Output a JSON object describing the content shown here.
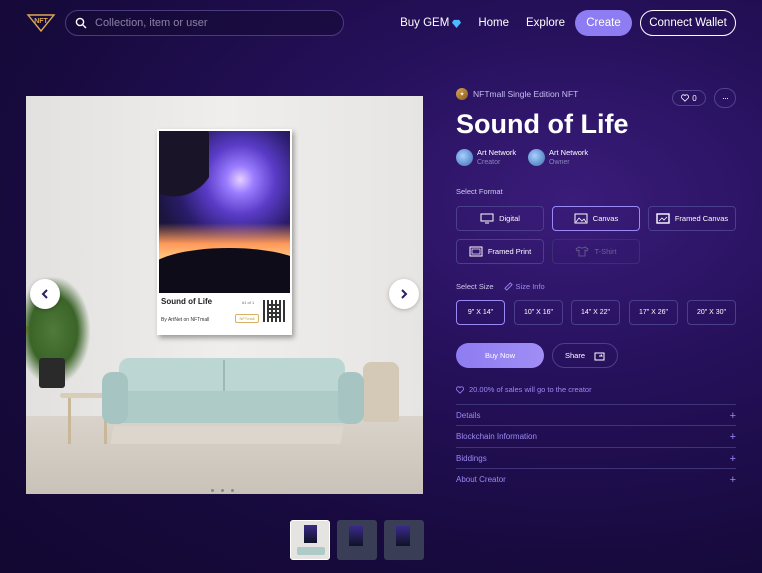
{
  "header": {
    "logo_text": "NFT",
    "search_placeholder": "Collection, item or user",
    "nav": {
      "buy_gem": "Buy GEM",
      "home": "Home",
      "explore": "Explore",
      "create": "Create",
      "connect_wallet": "Connect Wallet"
    }
  },
  "artwork": {
    "caption_title": "Sound of Life",
    "caption_edition": "#1 of 1",
    "caption_by": "By ArtNet on NFTmall",
    "caption_logo": "NFTmall"
  },
  "thumbnails": [
    "thumb-1",
    "thumb-2",
    "thumb-3"
  ],
  "panel": {
    "edition": "NFTmall Single Edition NFT",
    "likes": "0",
    "more": "···",
    "title": "Sound of Life",
    "creator": {
      "name": "Art Network",
      "role": "Creator"
    },
    "owner": {
      "name": "Art Network",
      "role": "Owner"
    },
    "select_format_label": "Select Format",
    "formats": [
      {
        "label": "Digital",
        "selected": false,
        "disabled": false
      },
      {
        "label": "Canvas",
        "selected": true,
        "disabled": false
      },
      {
        "label": "Framed Canvas",
        "selected": false,
        "disabled": false
      },
      {
        "label": "Framed Print",
        "selected": false,
        "disabled": false
      },
      {
        "label": "T-Shirt",
        "selected": false,
        "disabled": true
      }
    ],
    "select_size_label": "Select Size",
    "size_info": "Size Info",
    "sizes": [
      "9\" X 14\"",
      "10\" X 16\"",
      "14\" X 22\"",
      "17\" X 26\"",
      "20\" X 30\""
    ],
    "selected_size": "9\" X 14\"",
    "buy_now": "Buy Now",
    "share": "Share",
    "royalty": "20.00% of sales will go to the creator",
    "accordions": [
      "Details",
      "Blockchain Information",
      "Biddings",
      "About Creator"
    ],
    "accent_color": "#8e7cf2"
  }
}
